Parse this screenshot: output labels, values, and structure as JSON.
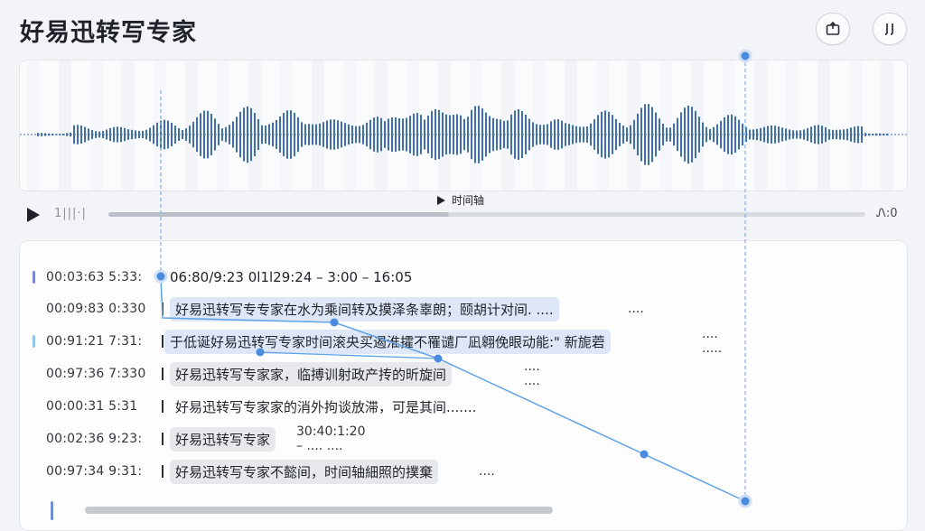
{
  "app": {
    "title": "好易迅转写专家"
  },
  "toolbar": {
    "export_icon": "export-icon",
    "split_icon": "split-icon"
  },
  "player": {
    "timeline_label": "时间轴",
    "mini_wave_label": "1|||·|",
    "duration": "Ꮑ:0",
    "progress": 0.45
  },
  "transcript": {
    "header": {
      "time": "00:03:63  5:33:",
      "text": "06:80/9:23   0l1l29:24 – 3:00 – 16:05"
    },
    "rows": [
      {
        "time": "00:09:83  0:330",
        "text": "好易迅转写专专家在水为乘间转及摸泽条辜朗；颐胡计对间.  ....",
        "trail": "...."
      },
      {
        "time": "00:91:21  7:31:",
        "text": "于低诞好易迅转写专家时间滚央买遏淮攉不罹谴厂凪翱俛眼动能:\" 新旎菪",
        "trail": "....  ....."
      },
      {
        "time": "00:97:36  7:330",
        "text": "好易迅转写专家家，临搏训射政产抟的昕旋间",
        "trail": "....  ...."
      },
      {
        "time": "00:00:31  5:31",
        "text": "好易迅转写专家家的消外拘谈放滞，可是其间.......",
        "trail": ""
      },
      {
        "time": "00:02:36  9:23:",
        "text": "好易迅转写专家",
        "trail": "30:40:1:20 – ....  ...."
      },
      {
        "time": "00:97:34  9:31:",
        "text": "好易迅转写专家不懿间，时间轴細照的撲棄",
        "trail": "...."
      }
    ]
  },
  "colors": {
    "accent": "#4a8be0",
    "wave": "#3f6fae",
    "highlight": "#dde7f7"
  }
}
